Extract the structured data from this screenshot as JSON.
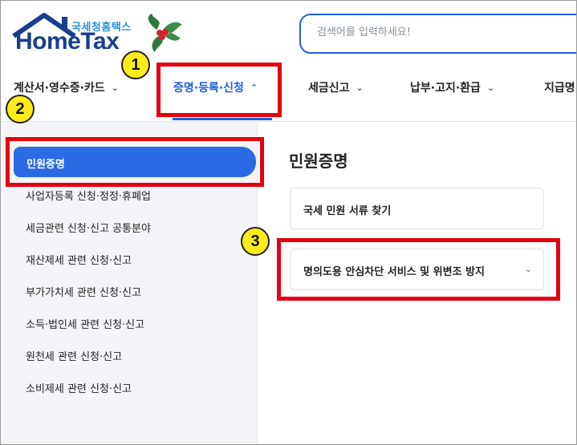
{
  "logo": {
    "subtitle": "국세청홈택스",
    "title": "HomeTax"
  },
  "search": {
    "placeholder": "검색어를 입력하세요!"
  },
  "nav": {
    "items": [
      {
        "label": "계산서·영수증·카드"
      },
      {
        "label": "증명·등록·신청"
      },
      {
        "label": "세금신고"
      },
      {
        "label": "납부·고지·환급"
      },
      {
        "label": "지급명"
      }
    ]
  },
  "sidebar": {
    "active": "민원증명",
    "items": [
      {
        "label": "사업자등록 신청·정정·휴폐업"
      },
      {
        "label": "세금관련 신청·신고 공통분야"
      },
      {
        "label": "재산제세 관련 신청·신고"
      },
      {
        "label": "부가가치세 관련 신청·신고"
      },
      {
        "label": "소득·법인세 관련 신청·신고"
      },
      {
        "label": "원천세 관련 신청·신고"
      },
      {
        "label": "소비제세 관련 신청·신고"
      }
    ]
  },
  "main": {
    "title": "민원증명",
    "cards": [
      {
        "label": "국세 민원 서류 찾기"
      },
      {
        "label": "명의도용 안심차단 서비스 및 위변조 방지"
      }
    ]
  },
  "annotations": {
    "badges": [
      "1",
      "2",
      "3"
    ],
    "highlight_color": "#e3000f",
    "badge_color": "#ffec1a"
  },
  "colors": {
    "accent": "#1f5fe0",
    "brand": "#173f8e",
    "sidebar_bg": "#f3f5f9"
  },
  "icons": {
    "nav_chevron": "chevron-down-icon",
    "active_chevron": "chevron-up-icon",
    "card_chevron": "chevron-down-icon"
  }
}
